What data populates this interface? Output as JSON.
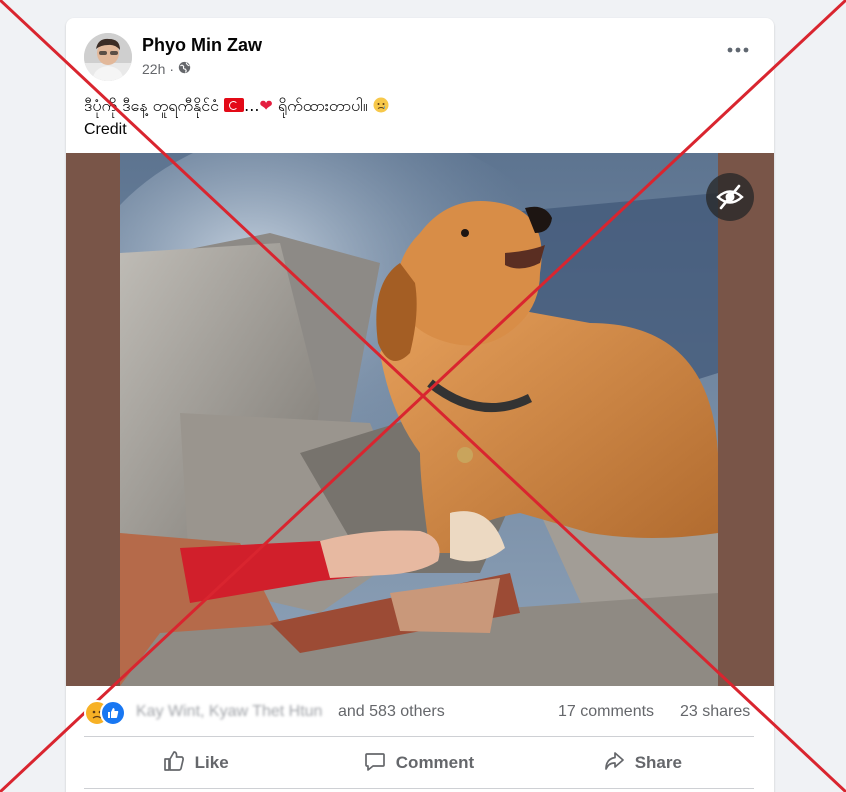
{
  "post": {
    "author": "Phyo Min Zaw",
    "time": "22h",
    "privacy_icon": "globe-icon",
    "more_icon": "more-options-icon",
    "caption_text": "ဒီပုံကို ဒီနေ့ တူရကီနိုင်ငံ",
    "caption_ellipsis": "...",
    "caption_tail": "ရိုက်ထားတာပါ။",
    "credit": "Credit",
    "image_alt": "Golden retriever on earthquake rubble resting its paw on a person's hand",
    "photo_hide_icon": "eye-slash-icon"
  },
  "reactions": {
    "icons": [
      "sad-reaction-icon",
      "like-reaction-icon"
    ],
    "names_blurred": "Kay Wint, Kyaw Thet Htun",
    "others": "and 583 others",
    "comments": "17 comments",
    "shares": "23 shares"
  },
  "actions": {
    "like": "Like",
    "comment": "Comment",
    "share": "Share"
  },
  "overlay": {
    "cross_color": "#d9252f"
  }
}
